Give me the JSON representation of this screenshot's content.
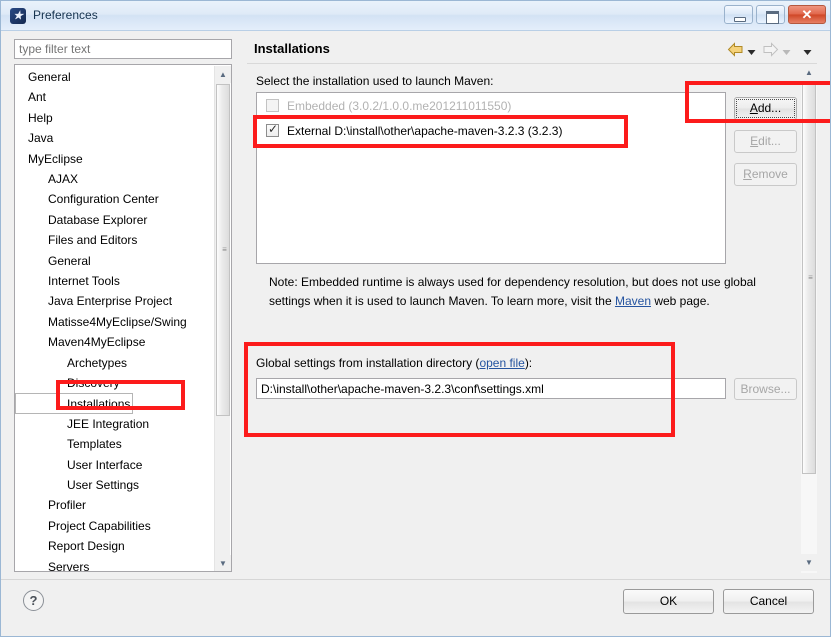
{
  "window": {
    "title": "Preferences",
    "app_icon": "myeclipse-icon",
    "controls": {
      "minimize": "minimize-button",
      "maximize": "maximize-button",
      "close": "✕"
    }
  },
  "filter": {
    "placeholder": "type filter text",
    "value": ""
  },
  "sidebar": {
    "items": [
      {
        "label": "General",
        "indent": 0,
        "selected": false
      },
      {
        "label": "Ant",
        "indent": 0,
        "selected": false
      },
      {
        "label": "Help",
        "indent": 0,
        "selected": false
      },
      {
        "label": "Java",
        "indent": 0,
        "selected": false
      },
      {
        "label": "MyEclipse",
        "indent": 0,
        "selected": false
      },
      {
        "label": "AJAX",
        "indent": 1,
        "selected": false
      },
      {
        "label": "Configuration Center",
        "indent": 1,
        "selected": false
      },
      {
        "label": "Database Explorer",
        "indent": 1,
        "selected": false
      },
      {
        "label": "Files and Editors",
        "indent": 1,
        "selected": false
      },
      {
        "label": "General",
        "indent": 1,
        "selected": false
      },
      {
        "label": "Internet Tools",
        "indent": 1,
        "selected": false
      },
      {
        "label": "Java Enterprise Project",
        "indent": 1,
        "selected": false
      },
      {
        "label": "Matisse4MyEclipse/Swing",
        "indent": 1,
        "selected": false
      },
      {
        "label": "Maven4MyEclipse",
        "indent": 1,
        "selected": false
      },
      {
        "label": "Archetypes",
        "indent": 2,
        "selected": false
      },
      {
        "label": "Discovery",
        "indent": 2,
        "selected": false
      },
      {
        "label": "Installations",
        "indent": 2,
        "selected": true
      },
      {
        "label": "JEE Integration",
        "indent": 2,
        "selected": false
      },
      {
        "label": "Templates",
        "indent": 2,
        "selected": false
      },
      {
        "label": "User Interface",
        "indent": 2,
        "selected": false
      },
      {
        "label": "User Settings",
        "indent": 2,
        "selected": false
      },
      {
        "label": "Profiler",
        "indent": 1,
        "selected": false
      },
      {
        "label": "Project Capabilities",
        "indent": 1,
        "selected": false
      },
      {
        "label": "Report Design",
        "indent": 1,
        "selected": false
      },
      {
        "label": "Servers",
        "indent": 1,
        "selected": false
      }
    ]
  },
  "main": {
    "title": "Installations",
    "nav": {
      "back": "back-arrow-icon",
      "back_menu": "chevron-down-icon",
      "forward": "forward-arrow-icon",
      "forward_menu": "chevron-down-icon",
      "view_menu": "chevron-down-icon"
    },
    "select_label": "Select the installation used to launch Maven:",
    "installations": [
      {
        "label": "Embedded (3.0.2/1.0.0.me201211011550)",
        "checked": false,
        "enabled": false
      },
      {
        "label": "External D:\\install\\other\\apache-maven-3.2.3 (3.2.3)",
        "checked": true,
        "enabled": true
      }
    ],
    "buttons": {
      "add": "Add...",
      "add_mnemonic": "A",
      "edit": "Edit...",
      "edit_mnemonic": "E",
      "remove": "Remove",
      "remove_mnemonic": "R",
      "browse": "Browse..."
    },
    "note": {
      "part1": "Note: Embedded runtime is always used for dependency resolution, but does not use global settings when it is used to launch Maven. To learn more, visit the ",
      "link": "Maven",
      "part2": " web page."
    },
    "global_settings": {
      "label_prefix": "Global settings from installation directory (",
      "link": "open file",
      "label_suffix": "):",
      "value": "D:\\install\\other\\apache-maven-3.2.3\\conf\\settings.xml"
    }
  },
  "footer": {
    "help": "?",
    "ok": "OK",
    "cancel": "Cancel"
  },
  "annotations": {
    "color": "#fc1b1b",
    "boxes": [
      "sidebar-installations",
      "external-installation-row",
      "add-button",
      "global-settings-section"
    ]
  }
}
